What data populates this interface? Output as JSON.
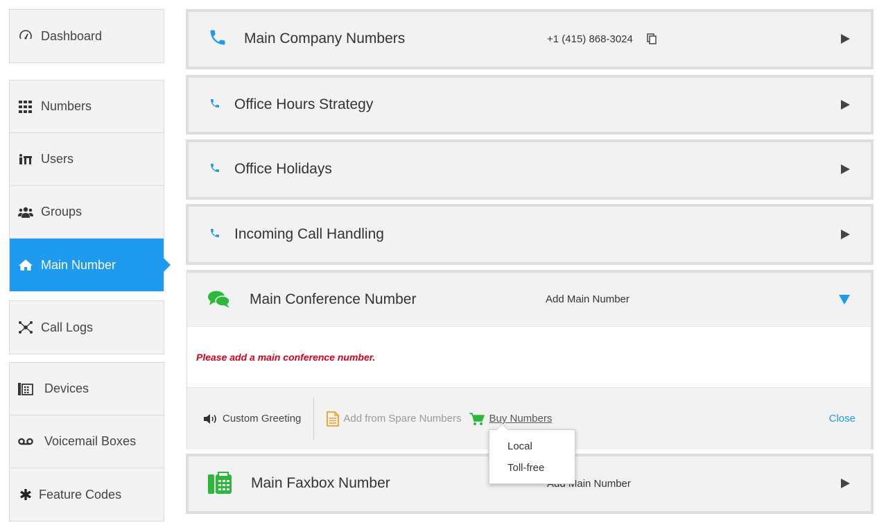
{
  "sidebar": {
    "dashboard": {
      "label": "Dashboard",
      "icon": "speedometer-icon"
    },
    "items": [
      {
        "label": "Numbers",
        "icon": "grid-icon"
      },
      {
        "label": "Users",
        "icon": "users-icon"
      },
      {
        "label": "Groups",
        "icon": "group-icon"
      },
      {
        "label": "Main Number",
        "icon": "home-icon",
        "active": true
      }
    ],
    "items2": [
      {
        "label": "Call Logs",
        "icon": "call-logs-icon"
      }
    ],
    "items3": [
      {
        "label": "Devices",
        "icon": "devices-icon"
      },
      {
        "label": "Voicemail Boxes",
        "icon": "voicemail-icon"
      },
      {
        "label": "Feature Codes",
        "icon": "asterisk-icon"
      }
    ]
  },
  "panels": {
    "company": {
      "title": "Main Company Numbers",
      "number": "+1 (415) 868-3024"
    },
    "hours": {
      "title": "Office Hours Strategy"
    },
    "holidays": {
      "title": "Office Holidays"
    },
    "incoming": {
      "title": "Incoming Call Handling"
    },
    "conference": {
      "title": "Main Conference Number",
      "add_label": "Add Main Number",
      "warning": "Please add a main conference number.",
      "custom_greeting": "Custom Greeting",
      "add_spare": "Add from Spare Numbers",
      "buy_numbers": "Buy Numbers",
      "close": "Close"
    },
    "faxbox": {
      "title": "Main Faxbox Number",
      "add_label": "Add Main Number"
    }
  },
  "dropdown": {
    "options": [
      "Local",
      "Toll-free"
    ]
  },
  "colors": {
    "accent": "#1e9bef",
    "green": "#2db83d",
    "warning": "#d9001b"
  }
}
